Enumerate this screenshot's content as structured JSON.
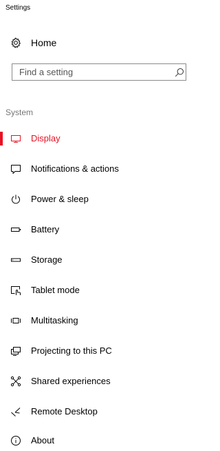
{
  "window": {
    "title": "Settings"
  },
  "home": {
    "label": "Home",
    "icon": "gear-icon"
  },
  "search": {
    "placeholder": "Find a setting",
    "icon": "search-icon"
  },
  "section": {
    "label": "System"
  },
  "accent_color": "#e81123",
  "nav": {
    "selected": "Display",
    "items": [
      {
        "label": "Display",
        "icon": "monitor-icon"
      },
      {
        "label": "Notifications & actions",
        "icon": "notification-icon"
      },
      {
        "label": "Power & sleep",
        "icon": "power-icon"
      },
      {
        "label": "Battery",
        "icon": "battery-icon"
      },
      {
        "label": "Storage",
        "icon": "storage-icon"
      },
      {
        "label": "Tablet mode",
        "icon": "tablet-mode-icon"
      },
      {
        "label": "Multitasking",
        "icon": "multitasking-icon"
      },
      {
        "label": "Projecting to this PC",
        "icon": "projecting-icon"
      },
      {
        "label": "Shared experiences",
        "icon": "shared-experiences-icon"
      },
      {
        "label": "Remote Desktop",
        "icon": "remote-desktop-icon"
      },
      {
        "label": "About",
        "icon": "info-icon"
      }
    ]
  }
}
